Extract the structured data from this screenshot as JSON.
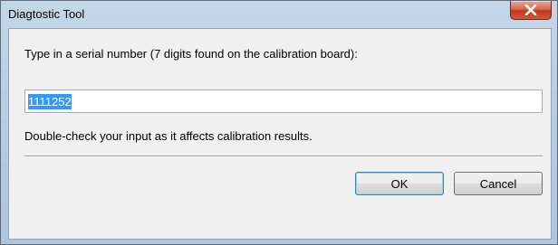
{
  "window": {
    "title": "Diagtostic Tool"
  },
  "dialog": {
    "prompt": "Type in a serial number (7 digits found on the calibration board):",
    "serial_value": "1111252",
    "hint": "Double-check your input as it affects calibration results.",
    "ok_label": "OK",
    "cancel_label": "Cancel"
  },
  "icons": {
    "close": "close-icon"
  },
  "colors": {
    "selection": "#3399ff",
    "close_button": "#c2391c"
  }
}
